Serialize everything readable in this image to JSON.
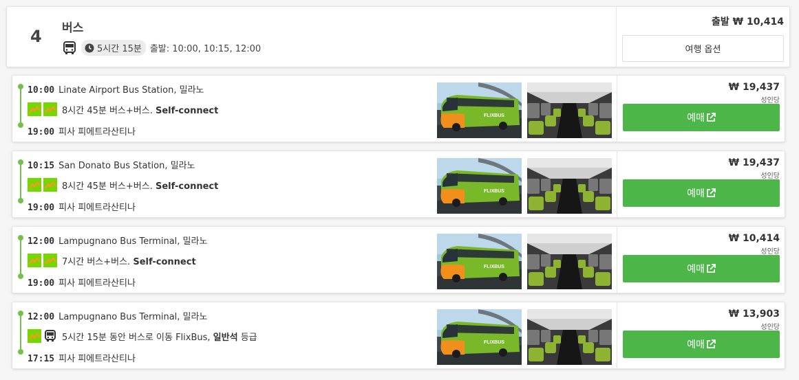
{
  "header": {
    "rank": "4",
    "mode_title": "버스",
    "duration": "5시간 15분",
    "departures": "출발: 10:00, 10:15, 12:00",
    "depart_price": "출발 ₩ 10,414",
    "options_label": "여행 옵션"
  },
  "trips": [
    {
      "dep_time": "10:00",
      "dep_station": "Linate Airport Bus Station, 밀라노",
      "segment_text": "8시간 45분 버스+버스. ",
      "segment_bold": "Self-connect",
      "arr_time": "19:00",
      "arr_station": "피사 피에트라산티나",
      "price": "₩ 19,437",
      "per_label": "성인당",
      "book_label": "예매"
    },
    {
      "dep_time": "10:15",
      "dep_station": "San Donato Bus Station, 밀라노",
      "segment_text": "8시간 45분 버스+버스. ",
      "segment_bold": "Self-connect",
      "arr_time": "19:00",
      "arr_station": "피사 피에트라산티나",
      "price": "₩ 19,437",
      "per_label": "성인당",
      "book_label": "예매"
    },
    {
      "dep_time": "12:00",
      "dep_station": "Lampugnano Bus Terminal, 밀라노",
      "segment_text": "7시간 버스+버스. ",
      "segment_bold": "Self-connect",
      "arr_time": "19:00",
      "arr_station": "피사 피에트라산티나",
      "price": "₩ 10,414",
      "per_label": "성인당",
      "book_label": "예매"
    },
    {
      "dep_time": "12:00",
      "dep_station": "Lampugnano Bus Terminal, 밀라노",
      "segment_text": "5시간 15분 동안 버스로 이동 FlixBus, ",
      "segment_bold": "일반석",
      "segment_suffix": " 등급",
      "arr_time": "17:15",
      "arr_station": "피사 피에트라산티나",
      "price": "₩ 13,903",
      "per_label": "성인당",
      "book_label": "예매"
    }
  ],
  "icons": {
    "bus": "bus-icon",
    "clock": "clock-icon",
    "external": "external-link-icon",
    "operator": "flixbus-logo-icon"
  },
  "colors": {
    "accent_green": "#4cb748",
    "timeline_green": "#73c04b",
    "flix_orange": "#f79a24"
  }
}
